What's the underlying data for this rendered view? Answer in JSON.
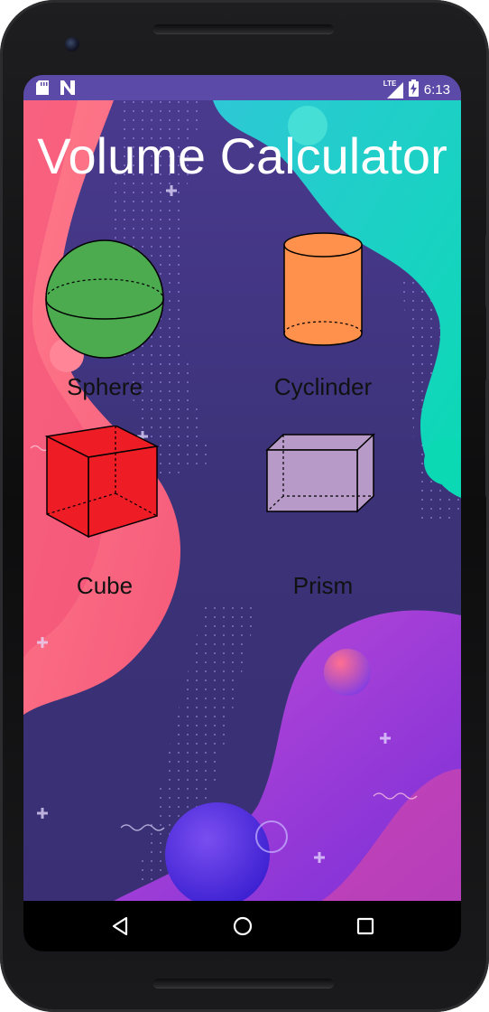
{
  "status_bar": {
    "time": "6:13",
    "network_label": "LTE",
    "icons": [
      "sd-card-icon",
      "n-notification-icon",
      "lte-signal-icon",
      "battery-charging-icon"
    ],
    "background_color": "#5c4aa8"
  },
  "app": {
    "title": "Volume Calculator",
    "shapes": [
      {
        "label": "Sphere",
        "icon": "sphere-icon",
        "color": "#4caa4f"
      },
      {
        "label": "Cyclinder",
        "icon": "cylinder-icon",
        "color": "#ff914d"
      },
      {
        "label": "Cube",
        "icon": "cube-icon",
        "color": "#ee1c25"
      },
      {
        "label": "Prism",
        "icon": "prism-icon",
        "color": "#b79ac8"
      }
    ]
  },
  "navigation": {
    "buttons": [
      "back-icon",
      "home-icon",
      "recents-icon"
    ]
  }
}
